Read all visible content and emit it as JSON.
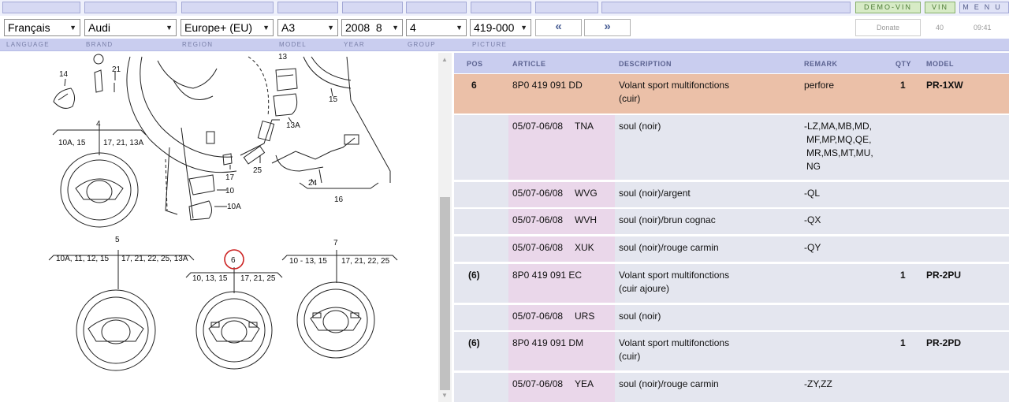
{
  "topbar": {
    "demo_vin": "DEMO-VIN",
    "vin": "VIN",
    "menu": "MENU"
  },
  "selectors": {
    "language": "Français",
    "brand": "Audi",
    "region": "Europe+ (EU)",
    "model": "A3",
    "year": "2008  8",
    "group": "4",
    "picture": "419-000",
    "prev": "«",
    "next": "»",
    "donate": "Donate",
    "count": "40",
    "time": "09:41"
  },
  "labels": [
    "LANGUAGE",
    "BRAND",
    "REGION",
    "MODEL",
    "YEAR",
    "GROUP",
    "PICTURE"
  ],
  "diagram": {
    "callouts": [
      "14",
      "21",
      "13",
      "15",
      "13A",
      "4",
      "17",
      "25",
      "10",
      "10A",
      "24",
      "16",
      "5",
      "6",
      "7"
    ],
    "group4": {
      "left": "10A, 15",
      "right": "17, 21, 13A"
    },
    "group5": {
      "left": "10A, 11, 12, 15",
      "right": "17, 21, 22, 25, 13A"
    },
    "group6": {
      "left": "10, 13, 15",
      "right": "17, 21, 25"
    },
    "group7": {
      "left": "10 - 13, 15",
      "right": "17, 21, 22, 25"
    }
  },
  "table": {
    "headers": {
      "pos": "POS",
      "article": "ARTICLE",
      "description": "DESCRIPTION",
      "remark": "REMARK",
      "qty": "QTY",
      "model": "MODEL"
    },
    "rows": [
      {
        "pos": "6",
        "article": "8P0 419 091 DD",
        "code": "",
        "desc1": "Volant sport multifonctions",
        "desc2": "(cuir)",
        "remark": [
          "perfore"
        ],
        "qty": "1",
        "model": "PR-1XW",
        "highlight": true
      },
      {
        "pos": "",
        "article": "05/07-06/08",
        "code": "TNA",
        "desc1": "soul (noir)",
        "desc2": "",
        "remark": [
          "-LZ,MA,MB,MD,",
          "MF,MP,MQ,QE,",
          "MR,MS,MT,MU,",
          "NG"
        ],
        "qty": "",
        "model": ""
      },
      {
        "pos": "",
        "article": "05/07-06/08",
        "code": "WVG",
        "desc1": "soul (noir)/argent",
        "desc2": "",
        "remark": [
          "-QL"
        ],
        "qty": "",
        "model": ""
      },
      {
        "pos": "",
        "article": "05/07-06/08",
        "code": "WVH",
        "desc1": "soul (noir)/brun cognac",
        "desc2": "",
        "remark": [
          "-QX"
        ],
        "qty": "",
        "model": ""
      },
      {
        "pos": "",
        "article": "05/07-06/08",
        "code": "XUK",
        "desc1": "soul (noir)/rouge carmin",
        "desc2": "",
        "remark": [
          "-QY"
        ],
        "qty": "",
        "model": ""
      },
      {
        "pos": "(6)",
        "article": "8P0 419 091 EC",
        "code": "",
        "desc1": "Volant sport multifonctions",
        "desc2": "(cuir ajoure)",
        "remark": [],
        "qty": "1",
        "model": "PR-2PU"
      },
      {
        "pos": "",
        "article": "05/07-06/08",
        "code": "URS",
        "desc1": "soul (noir)",
        "desc2": "",
        "remark": [],
        "qty": "",
        "model": ""
      },
      {
        "pos": "(6)",
        "article": "8P0 419 091 DM",
        "code": "",
        "desc1": "Volant sport multifonctions",
        "desc2": "(cuir)",
        "remark": [],
        "qty": "1",
        "model": "PR-2PD"
      },
      {
        "pos": "",
        "article": "05/07-06/08",
        "code": "YEA",
        "desc1": "soul (noir)/rouge carmin",
        "desc2": "",
        "remark": [
          "-ZY,ZZ"
        ],
        "qty": "",
        "model": ""
      }
    ]
  },
  "colors": {
    "highlight_row": "#ebc0a8",
    "row_bg": "#e4e6ef",
    "article_col": "#ead7ea",
    "header_bg": "#c9cdef",
    "selected_callout": "#cc2222"
  }
}
